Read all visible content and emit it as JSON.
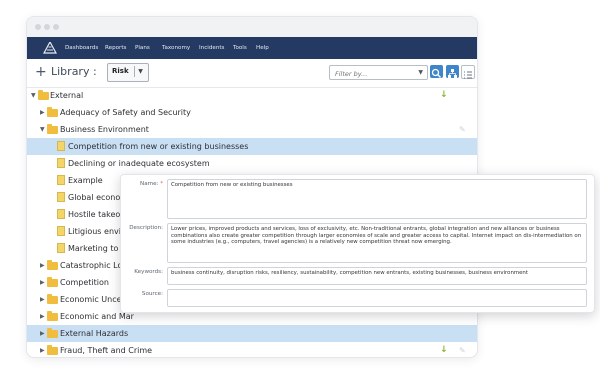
{
  "nav": {
    "items": [
      "Dashboards",
      "Reports",
      "Plans",
      "Taxonomy",
      "Incidents",
      "Tools",
      "Help"
    ]
  },
  "toolbar": {
    "add_symbol": "+",
    "library_label": "Library :",
    "library_value": "Risk",
    "filter_placeholder": "Filter by..."
  },
  "tree": {
    "rows": [
      "External",
      "Adequacy of Safety and Security",
      "Business Environment",
      "Competition from new or existing businesses",
      "Declining or inadequate ecosystem",
      "Example",
      "Global economic",
      "Hostile takeover",
      "Litigious enviror",
      "Marketing to th",
      "Catastrophic Loss",
      "Competition",
      "Economic Uncerta",
      "Economic and Mar",
      "External Hazards",
      "Fraud, Theft and Crime"
    ]
  },
  "detail": {
    "name_label": "Name:",
    "required_mark": "*",
    "name_value": "Competition from new or existing businesses",
    "description_label": "Description:",
    "description_value": "Lower prices, improved products and services, loss of exclusivity, etc. Non-traditional entrants, global integration and new alliances or business combinations also create greater competition through larger economies of scale and greater access to capital. Internet impact on dis-intermediation on some industries (e.g., computers, travel agencies) is a relatively new competition threat now emerging.",
    "keywords_label": "Keywords:",
    "keywords_value": "business continuity, disruption risks, resiliency, sustainability, competition new entrants, existing businesses, business environment",
    "source_label": "Source:",
    "source_value": ""
  },
  "colors": {
    "navbar": "#243a63",
    "selected_row": "#c9dff4",
    "folder": "#f0bd3f",
    "accent_button": "#3e85c9",
    "green_arrow": "#8bb528"
  },
  "icons": {
    "logo": "triangle-logo-icon",
    "search": "search-icon",
    "tree_view": "tree-view-icon",
    "list_view": "list-view-icon",
    "move_down": "arrow-down-icon",
    "link": "link-icon"
  }
}
